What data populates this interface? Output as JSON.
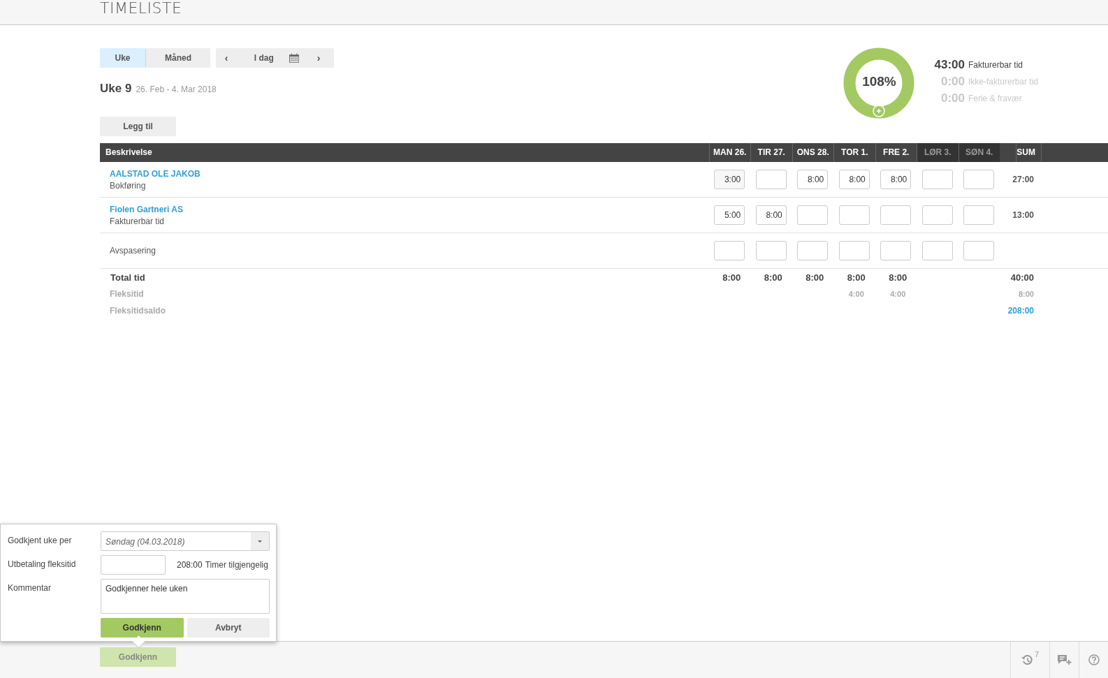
{
  "header": {
    "title": "TIMELISTE"
  },
  "view_tabs": [
    {
      "label": "Uke",
      "selected": true
    },
    {
      "label": "Måned",
      "selected": false
    }
  ],
  "date_nav": {
    "prev": "‹",
    "today": "I dag",
    "next": "›"
  },
  "week": {
    "title": "Uke 9",
    "range": "26. Feb - 4. Mar 2018"
  },
  "add_button": "Legg til",
  "summary": {
    "percent": "108%",
    "stats": [
      {
        "value": "43:00",
        "label": "Fakturerbar tid",
        "muted": false
      },
      {
        "value": "0:00",
        "label": "Ikke-fakturerbar tid",
        "muted": true
      },
      {
        "value": "0:00",
        "label": "Ferie & fravær",
        "muted": true
      }
    ]
  },
  "table": {
    "description_header": "Beskrivelse",
    "columns": [
      {
        "label": "MAN 26.",
        "weekend": false
      },
      {
        "label": "TIR 27.",
        "weekend": false
      },
      {
        "label": "ONS 28.",
        "weekend": false
      },
      {
        "label": "TOR 1.",
        "weekend": false
      },
      {
        "label": "FRE 2.",
        "weekend": false
      },
      {
        "label": "LØR 3.",
        "weekend": true
      },
      {
        "label": "SØN 4.",
        "weekend": true
      },
      {
        "label": "SUM",
        "weekend": false
      }
    ],
    "rows": [
      {
        "kind": "project",
        "title": "AALSTAD OLE JAKOB",
        "subtitle": "Bokføring",
        "cells": [
          "3:00",
          null,
          "8:00",
          "8:00",
          "8:00",
          null,
          null,
          "27:00"
        ]
      },
      {
        "kind": "project",
        "title": "Fiolen Gartneri AS",
        "subtitle": "Fakturerbar tid",
        "cells": [
          "5:00",
          "8:00",
          null,
          null,
          null,
          null,
          null,
          "13:00"
        ]
      },
      {
        "kind": "plain",
        "title": "Avspasering",
        "cells": [
          null,
          null,
          null,
          null,
          null,
          null,
          null,
          null
        ]
      }
    ],
    "totals": [
      {
        "kind": "total",
        "label": "Total tid",
        "cells": [
          "8:00",
          "8:00",
          "8:00",
          "8:00",
          "8:00",
          null,
          null,
          "40:00"
        ]
      },
      {
        "kind": "flex",
        "label": "Fleksitid",
        "cells": [
          null,
          null,
          null,
          "4:00",
          "4:00",
          null,
          null,
          "8:00"
        ]
      },
      {
        "kind": "balance",
        "label": "Fleksitidsaldo",
        "cells": [
          null,
          null,
          null,
          null,
          null,
          null,
          null,
          "208:00"
        ]
      }
    ]
  },
  "approval_popup": {
    "fields": [
      {
        "kind": "select",
        "label": "Godkjent uke per",
        "value": "Søndag (04.03.2018)"
      },
      {
        "kind": "number",
        "label": "Utbetaling fleksitid",
        "hours": "208:00",
        "note": "Timer tilgjengelig"
      },
      {
        "kind": "textarea",
        "label": "Kommentar",
        "value": "Godkjenner hele uken"
      }
    ],
    "confirm": "Godkjenn",
    "cancel": "Avbryt"
  },
  "footer": {
    "approve_button": "Godkjenn",
    "history_count": "7"
  }
}
